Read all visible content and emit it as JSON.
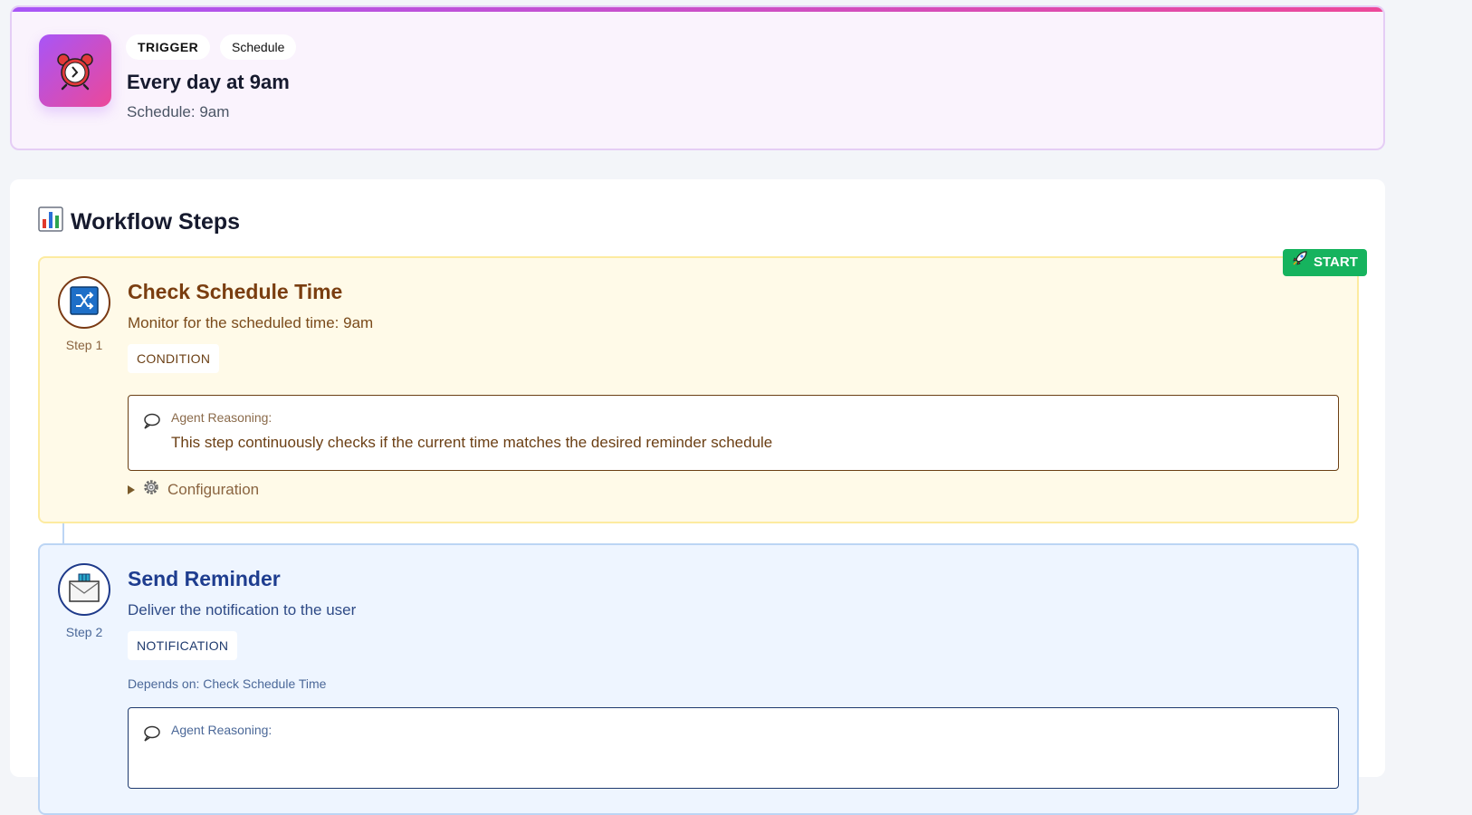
{
  "trigger": {
    "icon": "alarm-clock-icon",
    "type_chip": "TRIGGER",
    "kind_chip": "Schedule",
    "title": "Every day at 9am",
    "subtitle": "Schedule: 9am"
  },
  "workflow": {
    "title": "Workflow Steps",
    "title_icon": "bar-chart-icon",
    "start_badge": "START",
    "start_icon": "rocket-icon",
    "steps": [
      {
        "icon": "shuffle-icon",
        "step_label": "Step 1",
        "title": "Check Schedule Time",
        "description": "Monitor for the scheduled time: 9am",
        "type": "CONDITION",
        "reasoning_label": "Agent Reasoning:",
        "reasoning_text": "This step continuously checks if the current time matches the desired reminder schedule",
        "config_label": "Configuration"
      },
      {
        "icon": "mailbox-icon",
        "step_label": "Step 2",
        "title": "Send Reminder",
        "description": "Deliver the notification to the user",
        "type": "NOTIFICATION",
        "depends_on": "Depends on: Check Schedule Time",
        "reasoning_label": "Agent Reasoning:"
      }
    ]
  },
  "colors": {
    "accent_purple": "#a855f7",
    "accent_pink": "#ec4899",
    "start_green": "#16b35e",
    "condition_bg": "#fffae8",
    "notification_bg": "#eef5ff"
  }
}
